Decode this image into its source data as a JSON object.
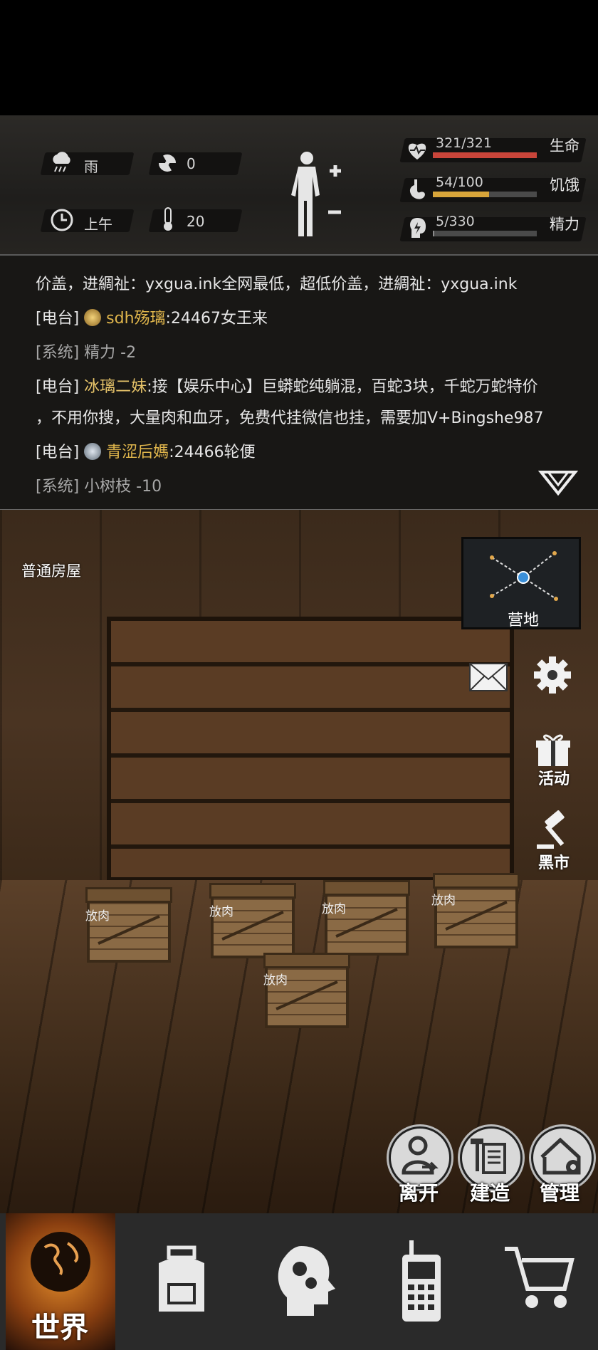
{
  "status": {
    "weather": "雨",
    "radiation": "0",
    "time_of_day": "上午",
    "temperature": "20",
    "health": {
      "label": "生命",
      "value": "321/321",
      "fraction": 1.0,
      "color": "#c9453a"
    },
    "hunger": {
      "label": "饥饿",
      "value": "54/100",
      "fraction": 0.54,
      "color": "#d8a53a"
    },
    "energy": {
      "label": "精力",
      "value": "5/330",
      "fraction": 0.015,
      "color": "#8a8a8a"
    }
  },
  "chat": {
    "line1": "价盖，进綢祉：yxgua.ink全网最低，超低价盖，进綢祉：yxgua.ink",
    "line2_tag": "[电台]",
    "line2_name": "sdh殇璃",
    "line2_msg": ":24467女王来",
    "line3": "[系统] 精力 -2",
    "line4_tag": "[电台]",
    "line4_name": "冰璃二妹",
    "line4_msg": ":接【娱乐中心】巨蟒蛇纯躺混，百蛇3块，千蛇万蛇特价",
    "line5": "，不用你搜，大量肉和血牙，免费代挂微信也挂，需要加V+Bingshe987",
    "line6_tag": "[电台]",
    "line6_name": "青涩后媽",
    "line6_msg": ":24466轮便",
    "line7": "[系统] 小树枝 -10"
  },
  "scene": {
    "location": "普通房屋",
    "map_label": "营地",
    "side_buttons": {
      "activity": "活动",
      "black_market": "黑市"
    },
    "crates": [
      "放肉",
      "放肉",
      "放肉",
      "放肉",
      "放肉"
    ],
    "actions": {
      "leave": "离开",
      "build": "建造",
      "manage": "管理"
    }
  },
  "nav": {
    "world": "世界"
  },
  "icons": [
    "rain-icon",
    "radiation-icon",
    "clock-icon",
    "thermometer-icon",
    "body-icon",
    "heart-icon",
    "stomach-icon",
    "energy-icon",
    "mail-icon",
    "gear-icon",
    "gift-icon",
    "gavel-icon",
    "globe-icon",
    "backpack-icon",
    "head-gears-icon",
    "walkie-talkie-icon",
    "cart-icon"
  ]
}
